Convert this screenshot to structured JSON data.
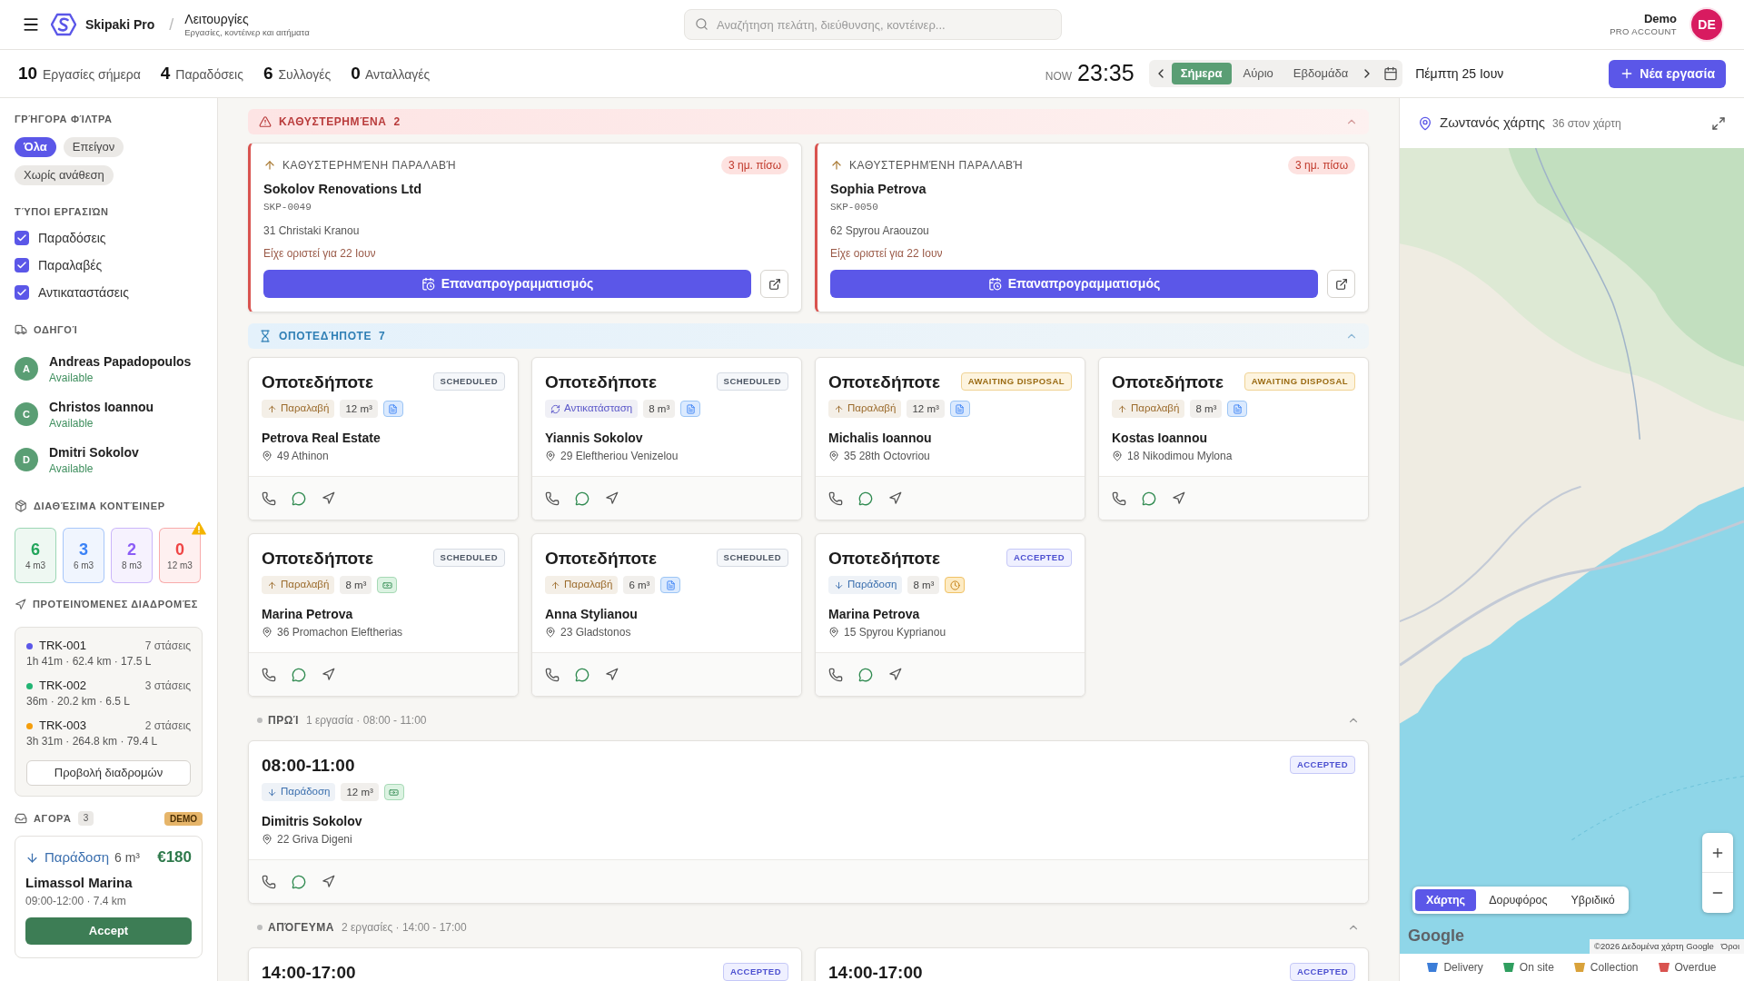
{
  "header": {
    "app_name": "Skipaki Pro",
    "separator": "/",
    "page_title": "Λειτουργίες",
    "page_subtitle": "Εργασίες, κοντέινερ και αιτήματα",
    "search": {
      "placeholder": "Αναζήτηση πελάτη, διεύθυνσης, κοντέινερ..."
    },
    "user": {
      "name": "Demo",
      "plan": "PRO ACCOUNT",
      "initials": "DE"
    }
  },
  "stats": [
    {
      "text": "**10** Εργασίες σήμερα"
    },
    {
      "text": "**4** Παραδόσεις"
    },
    {
      "text": "**6** Συλλογές"
    },
    {
      "text": "**0** Ανταλλαγές"
    }
  ],
  "clock": {
    "prefix": "NOW",
    "time": "23:35"
  },
  "date_nav": {
    "tabs": [
      {
        "label": "Σήμερα",
        "selected": true
      },
      {
        "label": "Αύριο",
        "selected": false
      },
      {
        "label": "Εβδομάδα",
        "selected": false
      }
    ],
    "date": "Πέμπτη 25 Ιουν"
  },
  "new_job_button": "Νέα εργασία",
  "sidebar": {
    "quick_filters": {
      "title": "ΓΡΉΓΟΡΑ ΦΊΛΤΡΑ",
      "chips": [
        {
          "label": "Όλα",
          "selected": true
        },
        {
          "label": "Επείγον",
          "selected": false
        },
        {
          "label": "Χωρίς ανάθεση",
          "selected": false
        }
      ]
    },
    "job_types": {
      "title": "ΤΎΠΟΙ ΕΡΓΑΣΙΏΝ",
      "items": [
        {
          "label": "Παραδόσεις",
          "checked": true
        },
        {
          "label": "Παραλαβές",
          "checked": true
        },
        {
          "label": "Αντικαταστάσεις",
          "checked": true
        }
      ]
    },
    "drivers": {
      "title": "ΟΔΗΓΟΊ",
      "items": [
        {
          "initial": "A",
          "name": "Andreas Papadopoulos",
          "status": "Available"
        },
        {
          "initial": "C",
          "name": "Christos Ioannou",
          "status": "Available"
        },
        {
          "initial": "D",
          "name": "Dmitri Sokolov",
          "status": "Available"
        }
      ]
    },
    "containers": {
      "title": "ΔΙΑΘΈΣΙΜΑ ΚΟΝΤΈΙΝΕΡ",
      "items": [
        {
          "count": "6",
          "size": "4 m3",
          "color": "#22a55b",
          "warning": false
        },
        {
          "count": "3",
          "size": "6 m3",
          "color": "#3b82f6",
          "warning": false
        },
        {
          "count": "2",
          "size": "8 m3",
          "color": "#8b5cf6",
          "warning": false
        },
        {
          "count": "0",
          "size": "12 m3",
          "color": "#ef4444",
          "warning": true
        }
      ]
    },
    "routes": {
      "title": "ΠΡΟΤΕΙΝΌΜΕΝΕΣ ΔΙΑΔΡΟΜΈΣ",
      "items": [
        {
          "id": "TRK-001",
          "color": "#5b57e8",
          "stops": "7 στάσεις",
          "metrics": "1h 41m · 62.4 km · 17.5 L"
        },
        {
          "id": "TRK-002",
          "color": "#22b573",
          "stops": "3 στάσεις",
          "metrics": "36m · 20.2 km · 6.5 L"
        },
        {
          "id": "TRK-003",
          "color": "#f59e0b",
          "stops": "2 στάσεις",
          "metrics": "3h 31m · 264.8 km · 79.4 L"
        }
      ],
      "button": "Προβολή διαδρομών"
    },
    "market": {
      "title": "ΑΓΟΡΆ",
      "count": "3",
      "badge": "DEMO",
      "offers": [
        {
          "type": {
            "kind": "delivery",
            "label": "Παράδοση"
          },
          "size": "6 m³",
          "price": "€180",
          "location": "Limassol Marina",
          "details": "09:00-12:00 · 7.4 km",
          "button": "Accept"
        }
      ]
    }
  },
  "main": {
    "sections": [
      {
        "kind": "overdue",
        "title": "ΚΑΘΥΣΤΕΡΗΜΈΝΑ",
        "count": "2",
        "expanded": true,
        "jobs": [
          {
            "type": {
              "kind": "pickup",
              "label": "ΚΑΘΥΣΤΕΡΗΜΈΝΗ ΠΑΡΑΛΑΒΉ"
            },
            "delay": "3 ημ. πίσω",
            "customer": "Sokolov Renovations Ltd",
            "ref": "SKP-0049",
            "address": "31 Christaki Kranou",
            "note": "Είχε οριστεί για 22 Ιουν",
            "action": "Επαναπρογραμματισμός"
          },
          {
            "type": {
              "kind": "pickup",
              "label": "ΚΑΘΥΣΤΕΡΗΜΈΝΗ ΠΑΡΑΛΑΒΉ"
            },
            "delay": "3 ημ. πίσω",
            "customer": "Sophia Petrova",
            "ref": "SKP-0050",
            "address": "62 Spyrou Araouzou",
            "note": "Είχε οριστεί για 22 Ιουν",
            "action": "Επαναπρογραμματισμός"
          }
        ]
      },
      {
        "kind": "anytime",
        "title": "ΟΠΟΤΕΔΉΠΟΤΕ",
        "count": "7",
        "expanded": true,
        "jobs": [
          {
            "title": "Οποτεδήποτε",
            "status": {
              "kind": "scheduled",
              "label": "SCHEDULED"
            },
            "type": {
              "kind": "pickup",
              "label": "Παραλαβή"
            },
            "size": "12 m³",
            "tag": {
              "kind": "document"
            },
            "customer": "Petrova Real Estate",
            "address": "49 Athinon"
          },
          {
            "title": "Οποτεδήποτε",
            "status": {
              "kind": "scheduled",
              "label": "SCHEDULED"
            },
            "type": {
              "kind": "replacement",
              "label": "Αντικατάσταση"
            },
            "size": "8 m³",
            "tag": {
              "kind": "document"
            },
            "customer": "Yiannis Sokolov",
            "address": "29 Eleftheriou Venizelou"
          },
          {
            "title": "Οποτεδήποτε",
            "status": {
              "kind": "awaiting",
              "label": "AWAITING DISPOSAL"
            },
            "type": {
              "kind": "pickup",
              "label": "Παραλαβή"
            },
            "size": "12 m³",
            "tag": {
              "kind": "document"
            },
            "customer": "Michalis Ioannou",
            "address": "35 28th Octovriou"
          },
          {
            "title": "Οποτεδήποτε",
            "status": {
              "kind": "awaiting",
              "label": "AWAITING DISPOSAL"
            },
            "type": {
              "kind": "pickup",
              "label": "Παραλαβή"
            },
            "size": "8 m³",
            "tag": {
              "kind": "document"
            },
            "customer": "Kostas Ioannou",
            "address": "18 Nikodimou Mylona"
          },
          {
            "title": "Οποτεδήποτε",
            "status": {
              "kind": "scheduled",
              "label": "SCHEDULED"
            },
            "type": {
              "kind": "pickup",
              "label": "Παραλαβή"
            },
            "size": "8 m³",
            "tag": {
              "kind": "cash"
            },
            "customer": "Marina Petrova",
            "address": "36 Promachon Eleftherias"
          },
          {
            "title": "Οποτεδήποτε",
            "status": {
              "kind": "scheduled",
              "label": "SCHEDULED"
            },
            "type": {
              "kind": "pickup",
              "label": "Παραλαβή"
            },
            "size": "6 m³",
            "tag": {
              "kind": "document"
            },
            "customer": "Anna Stylianou",
            "address": "23 Gladstonos"
          },
          {
            "title": "Οποτεδήποτε",
            "status": {
              "kind": "accepted",
              "label": "ACCEPTED"
            },
            "type": {
              "kind": "delivery",
              "label": "Παράδοση"
            },
            "size": "8 m³",
            "tag": {
              "kind": "clock"
            },
            "customer": "Marina Petrova",
            "address": "15 Spyrou Kyprianou"
          }
        ]
      },
      {
        "kind": "slot",
        "title": "ΠΡΩΊ",
        "summary": "1 εργασία · 08:00 - 11:00",
        "expanded": true,
        "jobs": [
          {
            "title": "08:00-11:00",
            "status": {
              "kind": "accepted",
              "label": "ACCEPTED"
            },
            "type": {
              "kind": "delivery",
              "label": "Παράδοση"
            },
            "size": "12 m³",
            "tag": {
              "kind": "cash"
            },
            "customer": "Dimitris Sokolov",
            "address": "22 Griva Digeni"
          }
        ]
      },
      {
        "kind": "slot",
        "title": "ΑΠΌΓΕΥΜΑ",
        "summary": "2 εργασίες · 14:00 - 17:00",
        "expanded": true,
        "jobs": [
          {
            "title": "14:00-17:00",
            "status": {
              "kind": "accepted",
              "label": "ACCEPTED"
            }
          },
          {
            "title": "14:00-17:00",
            "status": {
              "kind": "accepted",
              "label": "ACCEPTED"
            }
          }
        ]
      }
    ]
  },
  "map": {
    "title": "Ζωντανός χάρτης",
    "count": "36 στον χάρτη",
    "map_types": [
      {
        "label": "Χάρτης",
        "selected": true
      },
      {
        "label": "Δορυφόρος",
        "selected": false
      },
      {
        "label": "Υβριδικό",
        "selected": false
      }
    ],
    "logo": "Google",
    "attribution": "©2026 Δεδομένα χάρτη Google",
    "terms": "Όροι",
    "legend": [
      {
        "label": "Delivery",
        "color": "#3b7dd8"
      },
      {
        "label": "On site",
        "color": "#2f9e5f"
      },
      {
        "label": "Collection",
        "color": "#d9a23a"
      },
      {
        "label": "Overdue",
        "color": "#d9534f"
      }
    ]
  }
}
